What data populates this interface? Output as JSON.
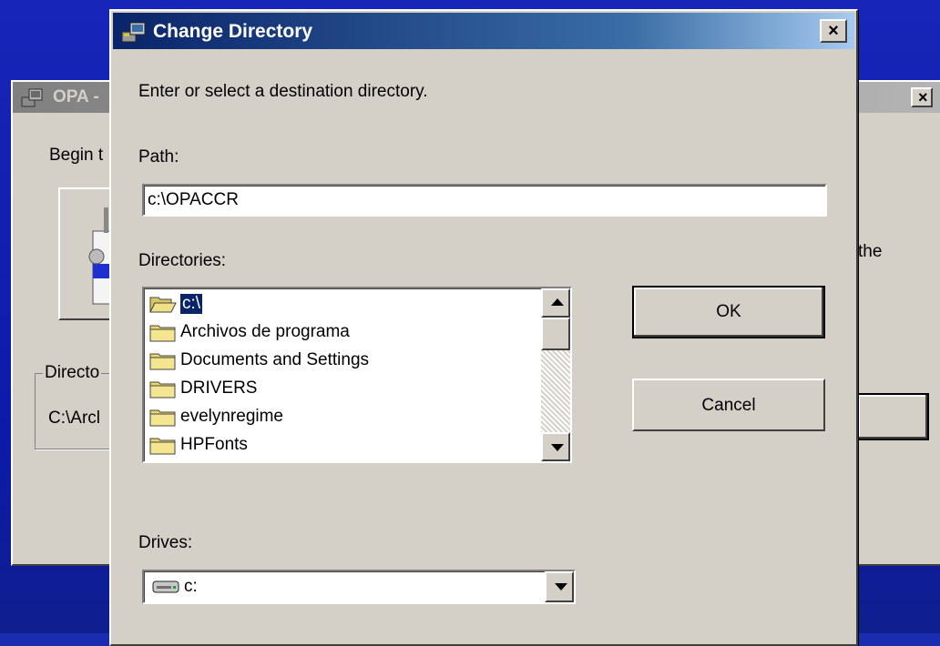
{
  "background_window": {
    "title": "OPA -",
    "close_glyph": "×",
    "begin_text": "Begin t",
    "side_text": "the",
    "group_legend": "Directo",
    "group_value": "C:\\Arcl"
  },
  "dialog": {
    "title": "Change Directory",
    "close_glyph": "×",
    "instruction": "Enter or select a destination directory.",
    "path_label": "Path:",
    "path_value": "c:\\OPACCR",
    "directories_label": "Directories:",
    "directories": [
      {
        "label": "c:\\",
        "open": true,
        "selected": true
      },
      {
        "label": "Archivos de programa",
        "open": false,
        "selected": false
      },
      {
        "label": "Documents and Settings",
        "open": false,
        "selected": false
      },
      {
        "label": "DRIVERS",
        "open": false,
        "selected": false
      },
      {
        "label": "evelynregime",
        "open": false,
        "selected": false
      },
      {
        "label": "HPFonts",
        "open": false,
        "selected": false
      }
    ],
    "ok_label": "OK",
    "cancel_label": "Cancel",
    "drives_label": "Drives:",
    "drive_value": "c:"
  },
  "icons": {
    "app": "setup-app-icon",
    "folder": "folder-icon",
    "folder_open": "folder-open-icon",
    "drive": "hard-drive-icon",
    "scroll_up": "arrow-up-icon",
    "scroll_down": "arrow-down-icon",
    "dropdown": "chevron-down-icon"
  },
  "colors": {
    "desktop": "#1a2cb0",
    "titlebar_active_start": "#0a246a",
    "titlebar_active_end": "#a6caf0",
    "titlebar_inactive": "#808080",
    "face": "#d4d0c8",
    "selection": "#0a246a",
    "folder": "#e8d66a"
  }
}
